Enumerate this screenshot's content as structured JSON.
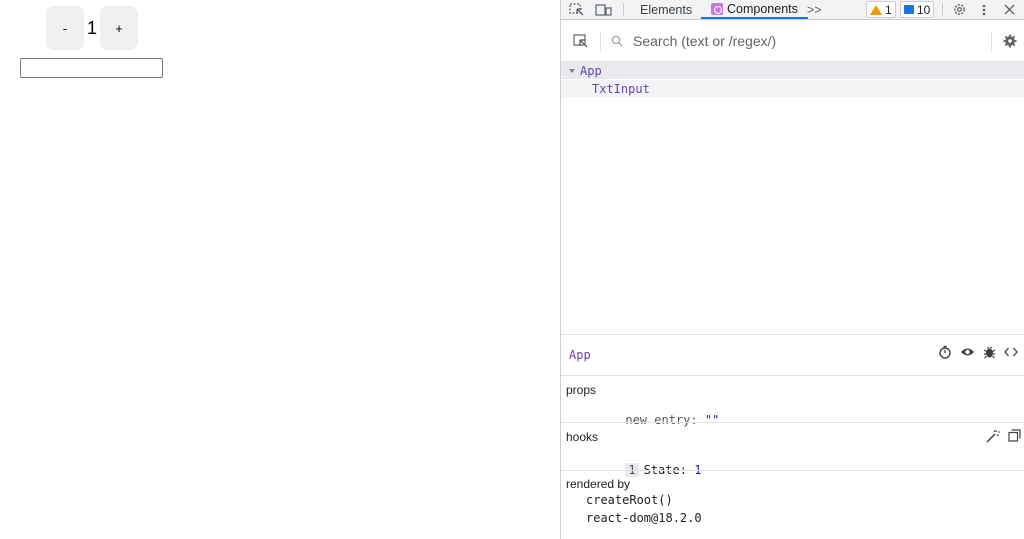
{
  "app": {
    "decrement_label": "-",
    "count": "1",
    "increment_label": "+"
  },
  "devtools": {
    "tabs": {
      "elements": "Elements",
      "components": "Components",
      "more": ">>"
    },
    "warnings_count": "1",
    "messages_count": "10",
    "search": {
      "placeholder": "Search (text or /regex/)"
    },
    "tree": [
      {
        "label": "App"
      },
      {
        "label": "TxtInput"
      }
    ],
    "selected": {
      "name": "App"
    },
    "props": {
      "title": "props",
      "key": "new entry:",
      "value": "\"\""
    },
    "hooks": {
      "title": "hooks",
      "index": "1",
      "key": "State:",
      "value": "1"
    },
    "rendered_by": {
      "title": "rendered by",
      "items": [
        "createRoot()",
        "react-dom@18.2.0"
      ]
    },
    "colors": {
      "component": "#6a3fb5",
      "accent": "#1a73e8",
      "warning": "#f29900"
    }
  }
}
